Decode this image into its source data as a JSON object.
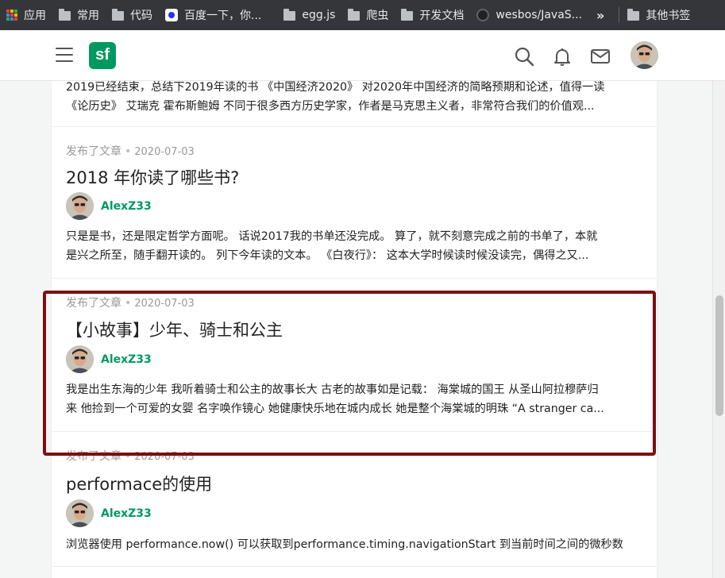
{
  "bookmarks": {
    "items": [
      {
        "label": "应用",
        "icon": "apps-grid-icon"
      },
      {
        "label": "常用",
        "icon": "folder-icon"
      },
      {
        "label": "代码",
        "icon": "folder-icon"
      },
      {
        "label": "百度一下，你...",
        "icon": "baidu-icon"
      },
      {
        "label": "egg.js",
        "icon": "folder-icon"
      },
      {
        "label": "爬虫",
        "icon": "folder-icon"
      },
      {
        "label": "开发文档",
        "icon": "folder-icon"
      },
      {
        "label": "wesbos/JavaS...",
        "icon": "github-icon"
      }
    ],
    "more": "»",
    "other": "其他书签"
  },
  "header": {
    "logo": "sf",
    "icons": [
      "menu-icon",
      "search-icon",
      "bell-icon",
      "mail-icon"
    ]
  },
  "feed": {
    "items": [
      {
        "excerpt": [
          "2019已经结束，总结下2019年读的书 《中国经济2020》 对2020年中国经济的简略预期和论述，值得一读",
          "《论历史》 艾瑞克 霍布斯鲍姆 不同于很多西方历史学家，作者是马克思主义者，非常符合我们的价值观..."
        ]
      },
      {
        "action": "发布了文章",
        "date": "2020-07-03",
        "title": "2018 年你读了哪些书?",
        "author": "AlexZ33",
        "excerpt": [
          "只是是书，还是限定哲学方面呢。 话说2017我的书单还没完成。 算了，就不刻意完成之前的书单了，本就",
          "是兴之所至，随手翻开读的。 列下今年读的文本。 《白夜行》： 这本大学时候读时候没读完，偶得之又..."
        ]
      },
      {
        "action": "发布了文章",
        "date": "2020-07-03",
        "title": "【小故事】少年、骑士和公主",
        "author": "AlexZ33",
        "excerpt": [
          "我是出生东海的少年 我听着骑士和公主的故事长大 古老的故事如是记载： 海棠城的国王 从圣山阿拉穆萨归",
          "来 他捡到一个可爱的女婴 名字唤作镜心 她健康快乐地在城内成长 她是整个海棠城的明珠 “A stranger ca..."
        ]
      },
      {
        "action": "发布了文章",
        "date": "2020-07-03",
        "title": "performace的使用",
        "author": "AlexZ33",
        "excerpt": [
          "浏览器使用 performance.now() 可以获取到performance.timing.navigationStart 到当前时间之间的微秒数"
        ]
      }
    ]
  },
  "colors": {
    "brand": "#009a61",
    "highlight": "#7c0f0f",
    "bookmarks_bar": "#35363a"
  }
}
